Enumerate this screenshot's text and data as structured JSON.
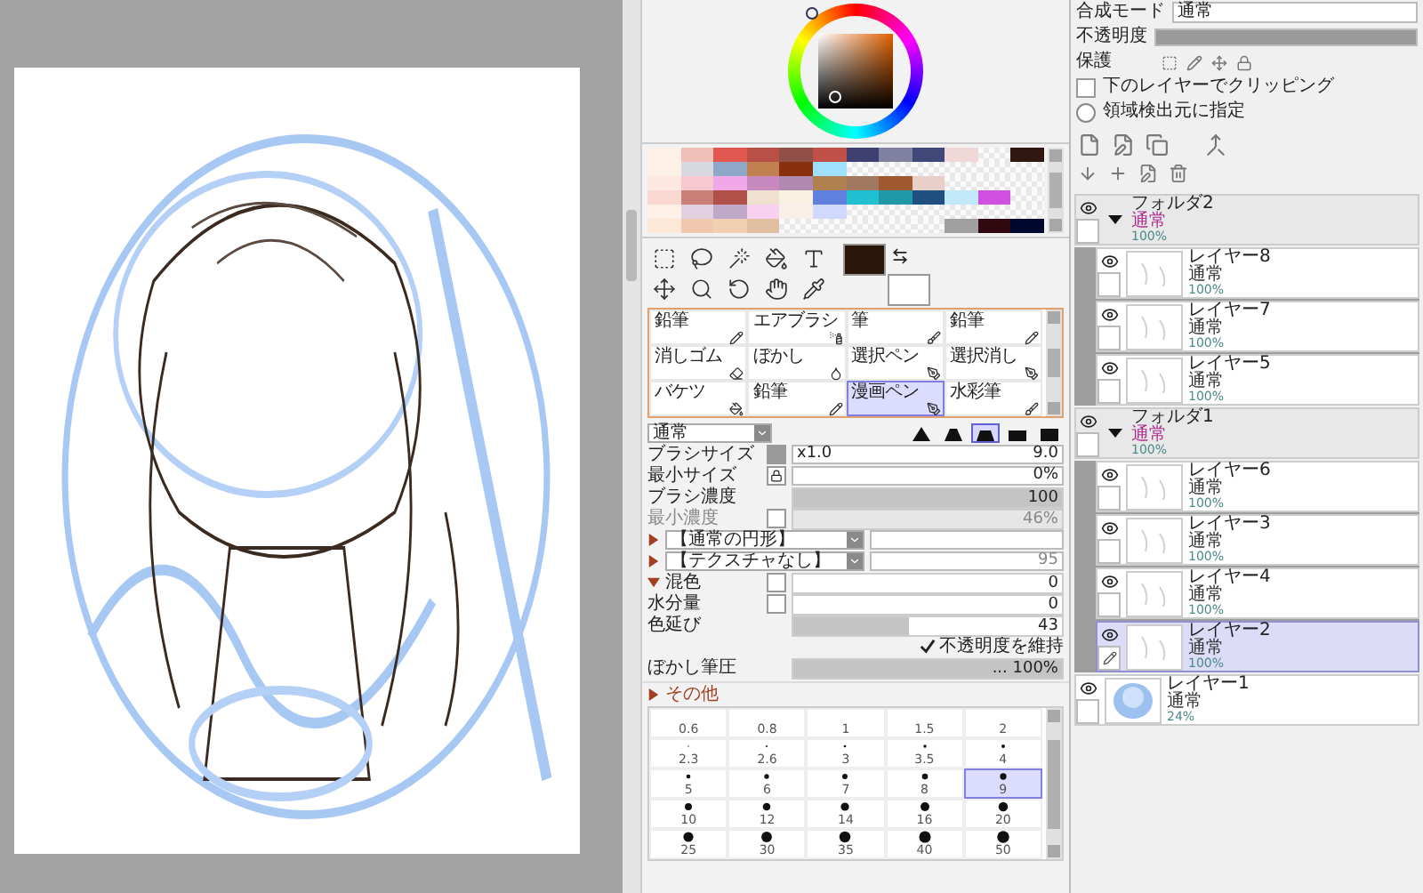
{
  "color_slots": [
    {
      "kind": "foreground",
      "color": "#2a1608"
    },
    {
      "kind": "background",
      "color": "#ffffff"
    }
  ],
  "palette": [
    {
      "kind": "color",
      "color": "#fdf0e6"
    },
    {
      "kind": "color",
      "color": "#f0c0b8"
    },
    {
      "kind": "color",
      "color": "#e05850"
    },
    {
      "kind": "color",
      "color": "#b85048"
    },
    {
      "kind": "color",
      "color": "#905048"
    },
    {
      "kind": "color",
      "color": "#c05048"
    },
    {
      "kind": "color",
      "color": "#404070"
    },
    {
      "kind": "color",
      "color": "#8080a0"
    },
    {
      "kind": "color",
      "color": "#404878"
    },
    {
      "kind": "color",
      "color": "#f0d8d8"
    },
    {
      "kind": "empty"
    },
    {
      "kind": "color",
      "color": "#301810"
    },
    {
      "kind": "color",
      "color": "#fdf0e6"
    },
    {
      "kind": "color",
      "color": "#d8d8e0"
    },
    {
      "kind": "color",
      "color": "#90a8c8"
    },
    {
      "kind": "color",
      "color": "#c08050"
    },
    {
      "kind": "color",
      "color": "#883010"
    },
    {
      "kind": "color",
      "color": "#a0e0ff"
    },
    {
      "kind": "empty"
    },
    {
      "kind": "empty"
    },
    {
      "kind": "empty"
    },
    {
      "kind": "empty"
    },
    {
      "kind": "empty"
    },
    {
      "kind": "empty"
    },
    {
      "kind": "color",
      "color": "#fde8e0"
    },
    {
      "kind": "color",
      "color": "#f8c8d0"
    },
    {
      "kind": "color",
      "color": "#f0a8e8"
    },
    {
      "kind": "color",
      "color": "#c888c0"
    },
    {
      "kind": "color",
      "color": "#b088b0"
    },
    {
      "kind": "color",
      "color": "#b08050"
    },
    {
      "kind": "color",
      "color": "#a07860"
    },
    {
      "kind": "color",
      "color": "#a05830"
    },
    {
      "kind": "color",
      "color": "#e8d0c8"
    },
    {
      "kind": "empty"
    },
    {
      "kind": "empty"
    },
    {
      "kind": "empty"
    },
    {
      "kind": "color",
      "color": "#f8d8d0"
    },
    {
      "kind": "color",
      "color": "#c88078"
    },
    {
      "kind": "color",
      "color": "#b05048"
    },
    {
      "kind": "color",
      "color": "#f0e0d0"
    },
    {
      "kind": "color",
      "color": "#f8f0e0"
    },
    {
      "kind": "color",
      "color": "#6080e0"
    },
    {
      "kind": "color",
      "color": "#20c0d0"
    },
    {
      "kind": "color",
      "color": "#2098a8"
    },
    {
      "kind": "color",
      "color": "#205080"
    },
    {
      "kind": "color",
      "color": "#c0e8f8"
    },
    {
      "kind": "color",
      "color": "#d050e0"
    },
    {
      "kind": "empty"
    },
    {
      "kind": "color",
      "color": "#fdf0e6"
    },
    {
      "kind": "color",
      "color": "#e0d0e0"
    },
    {
      "kind": "color",
      "color": "#c0a8c8"
    },
    {
      "kind": "color",
      "color": "#f8d0f0"
    },
    {
      "kind": "color",
      "color": "#f8f0e8"
    },
    {
      "kind": "color",
      "color": "#d0d8ff"
    },
    {
      "kind": "empty"
    },
    {
      "kind": "empty"
    },
    {
      "kind": "empty"
    },
    {
      "kind": "empty"
    },
    {
      "kind": "empty"
    },
    {
      "kind": "empty"
    },
    {
      "kind": "color",
      "color": "#fde8d8"
    },
    {
      "kind": "color",
      "color": "#f0c8b0"
    },
    {
      "kind": "color",
      "color": "#f0d0b0"
    },
    {
      "kind": "color",
      "color": "#e0c0a0"
    },
    {
      "kind": "empty"
    },
    {
      "kind": "empty"
    },
    {
      "kind": "empty"
    },
    {
      "kind": "empty"
    },
    {
      "kind": "empty"
    },
    {
      "kind": "color",
      "color": "#a0a0a0"
    },
    {
      "kind": "color",
      "color": "#300810"
    },
    {
      "kind": "color",
      "color": "#000830"
    }
  ],
  "brushes": [
    {
      "label": "鉛筆",
      "selected": false
    },
    {
      "label": "エアブラシ",
      "selected": false
    },
    {
      "label": "筆",
      "selected": false
    },
    {
      "label": "鉛筆",
      "selected": false
    },
    {
      "label": "消しゴム",
      "selected": false
    },
    {
      "label": "ぼかし",
      "selected": false
    },
    {
      "label": "選択ペン",
      "selected": false
    },
    {
      "label": "選択消し",
      "selected": false
    },
    {
      "label": "バケツ",
      "selected": false
    },
    {
      "label": "鉛筆",
      "selected": false
    },
    {
      "label": "漫画ペン",
      "selected": true
    },
    {
      "label": "水彩筆",
      "selected": false
    }
  ],
  "blend_mode": "通常",
  "brush_shapes": [
    {
      "selected": false
    },
    {
      "selected": false
    },
    {
      "selected": true
    },
    {
      "selected": false
    },
    {
      "selected": false
    }
  ],
  "settings": [
    {
      "kind": "size",
      "label": "ブラシサイズ",
      "multiplier": "x1.0",
      "value": "9.0"
    },
    {
      "kind": "percent",
      "label": "最小サイズ",
      "value": "0%"
    },
    {
      "kind": "bar",
      "label": "ブラシ濃度",
      "value": "100",
      "level": 1
    },
    {
      "kind": "check-bar",
      "label": "最小濃度",
      "checked": false,
      "disabled": true,
      "value": "46%",
      "level": 1
    },
    {
      "kind": "dropdown",
      "label": "【通常の円形】",
      "expanded": false
    },
    {
      "kind": "dropdown",
      "label": "【テクスチャなし】",
      "expanded": false,
      "value": "95",
      "disabled": true
    },
    {
      "kind": "check-bar",
      "label": "混色",
      "expanded": true,
      "checked": false,
      "disabled": false,
      "value": "0",
      "level": 0
    },
    {
      "kind": "check-bar",
      "label": "水分量",
      "checked": false,
      "disabled": false,
      "value": "0",
      "level": 0
    },
    {
      "kind": "bar",
      "label": "色延び",
      "value": "43",
      "level": 0.43
    },
    {
      "kind": "checkbox",
      "label": "不透明度を維持",
      "checked": true
    },
    {
      "kind": "bar",
      "label": "ぼかし筆圧",
      "value": "... 100%",
      "level": 1
    }
  ],
  "other": {
    "label": "その他",
    "expanded": false
  },
  "brush_sizes": [
    {
      "value": "0.6",
      "selected": false
    },
    {
      "value": "0.8",
      "selected": false
    },
    {
      "value": "1",
      "selected": false
    },
    {
      "value": "1.5",
      "selected": false
    },
    {
      "value": "2",
      "selected": false
    },
    {
      "value": "2.3",
      "selected": false
    },
    {
      "value": "2.6",
      "selected": false
    },
    {
      "value": "3",
      "selected": false
    },
    {
      "value": "3.5",
      "selected": false
    },
    {
      "value": "4",
      "selected": false
    },
    {
      "value": "5",
      "selected": false
    },
    {
      "value": "6",
      "selected": false
    },
    {
      "value": "7",
      "selected": false
    },
    {
      "value": "8",
      "selected": false
    },
    {
      "value": "9",
      "selected": true
    },
    {
      "value": "10",
      "selected": false
    },
    {
      "value": "12",
      "selected": false
    },
    {
      "value": "14",
      "selected": false
    },
    {
      "value": "16",
      "selected": false
    },
    {
      "value": "20",
      "selected": false
    },
    {
      "value": "25",
      "selected": false
    },
    {
      "value": "30",
      "selected": false
    },
    {
      "value": "35",
      "selected": false
    },
    {
      "value": "40",
      "selected": false
    },
    {
      "value": "50",
      "selected": false
    }
  ],
  "layer_properties": {
    "blend_label": "合成モード",
    "blend_value": "通常",
    "opacity": {
      "label": "不透明度",
      "level": 1
    },
    "protect_label": "保護",
    "clipping": {
      "label": "下のレイヤーでクリッピング",
      "checked": false
    },
    "selection_source": {
      "label": "領域検出元に指定",
      "selected": false
    }
  },
  "layers": [
    {
      "kind": "folder",
      "name": "フォルダ2",
      "mode": "通常",
      "opacity": "100%",
      "visible": true,
      "expanded": true,
      "selected": false,
      "children": [
        {
          "kind": "layer",
          "name": "レイヤー8",
          "mode": "通常",
          "opacity": "100%",
          "visible": true,
          "selected": false
        },
        {
          "kind": "layer",
          "name": "レイヤー7",
          "mode": "通常",
          "opacity": "100%",
          "visible": true,
          "selected": false
        },
        {
          "kind": "layer",
          "name": "レイヤー5",
          "mode": "通常",
          "opacity": "100%",
          "visible": true,
          "selected": false
        }
      ]
    },
    {
      "kind": "folder",
      "name": "フォルダ1",
      "mode": "通常",
      "opacity": "100%",
      "visible": true,
      "expanded": true,
      "selected": false,
      "children": [
        {
          "kind": "layer",
          "name": "レイヤー6",
          "mode": "通常",
          "opacity": "100%",
          "visible": true,
          "selected": false
        },
        {
          "kind": "layer",
          "name": "レイヤー3",
          "mode": "通常",
          "opacity": "100%",
          "visible": true,
          "selected": false
        },
        {
          "kind": "layer",
          "name": "レイヤー4",
          "mode": "通常",
          "opacity": "100%",
          "visible": true,
          "selected": false
        },
        {
          "kind": "layer",
          "name": "レイヤー2",
          "mode": "通常",
          "opacity": "100%",
          "visible": true,
          "selected": true
        }
      ]
    },
    {
      "kind": "layer",
      "name": "レイヤー1",
      "mode": "通常",
      "opacity": "24%",
      "visible": true,
      "selected": false
    }
  ]
}
